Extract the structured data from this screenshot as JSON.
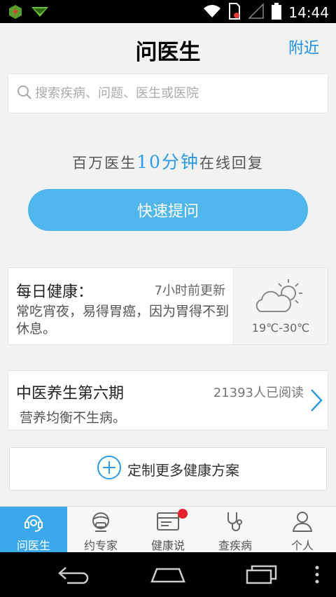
{
  "status_bar": {
    "time": "14:44",
    "icons": [
      "app-notification-icon",
      "mail-arrow-icon",
      "wifi-icon",
      "sim-icon",
      "signal-icon",
      "battery-icon"
    ]
  },
  "header": {
    "title": "问医生",
    "nearby_label": "附近"
  },
  "search": {
    "placeholder": "搜索疾病、问题、医生或医院",
    "value": ""
  },
  "slogan": {
    "prefix": "百万医生",
    "highlight": "10分钟",
    "suffix": "在线回复"
  },
  "ask_button": {
    "label": "快速提问"
  },
  "daily_health": {
    "title": "每日健康：",
    "updated": "7小时前更新",
    "body": "常吃宵夜，易得胃癌，因为胃得不到休息。",
    "weather": {
      "icon": "partly-cloudy-icon",
      "temperature": "19℃-30℃"
    }
  },
  "tcm_article": {
    "title": "中医养生第六期",
    "reads": "21393人已阅读",
    "subtitle": "营养均衡不生病。"
  },
  "custom_plan": {
    "label": "定制更多健康方案"
  },
  "tabs": [
    {
      "label": "问医生",
      "icon": "headset-icon",
      "active": true
    },
    {
      "label": "约专家",
      "icon": "doctor-icon",
      "active": false
    },
    {
      "label": "健康说",
      "icon": "card-icon",
      "active": false,
      "badge": true
    },
    {
      "label": "查疾病",
      "icon": "stethoscope-icon",
      "active": false
    },
    {
      "label": "个人",
      "icon": "person-icon",
      "active": false
    }
  ],
  "colors": {
    "accent": "#2e9be3",
    "button": "#51b6ec",
    "tab_active": "#3aa8ea",
    "badge": "#e8202a"
  }
}
